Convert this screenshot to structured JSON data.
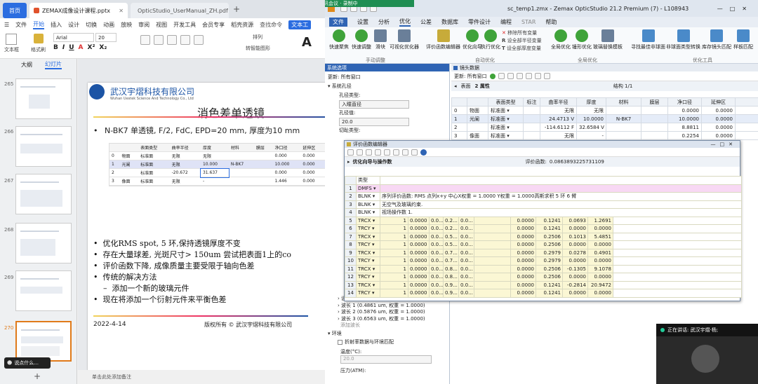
{
  "wps": {
    "tabs": {
      "home": "首页",
      "ppt": "ZEMAX成像设计课程.pptx",
      "pdf": "OpticStudio_UserManual_ZH.pdf"
    },
    "menu": [
      "文件",
      "开始",
      "插入",
      "设计",
      "切换",
      "动画",
      "放映",
      "审阅",
      "视图",
      "开发工具",
      "会员专享",
      "稻壳资源"
    ],
    "menu_selected": "开始",
    "menu_right": [
      "查找命令",
      "文本工"
    ],
    "toolbar": {
      "font": "Arial",
      "size": "20",
      "paste": "文本框",
      "format": "格式刷",
      "layout": "排列",
      "smart": "转智能图形"
    },
    "left_tabs": [
      "大纲",
      "幻灯片"
    ],
    "slide_numbers": [
      "265",
      "266",
      "267",
      "268",
      "269",
      "270"
    ],
    "status_text": "单击此处添加备注",
    "tooltip": "说点什么..."
  },
  "slide": {
    "company_cn": "武汉宇熠科技有限公司",
    "company_en": "Wuhan Uestek Science And Technology Co., Ltd",
    "title": "消色差单透镜",
    "bullet1": "N-BK7 单透镜, F/2, FdC, EPD=20 mm, 厚度为10 mm",
    "table_headers": [
      "表面类型",
      "曲率半径",
      "厚度",
      "材料",
      "膜层",
      "净口径",
      "延伸区"
    ],
    "table_rows": [
      [
        "0",
        "物面",
        "标准面",
        "无限",
        "无限",
        "",
        "",
        "0.000",
        "0.000"
      ],
      [
        "1",
        "光阑",
        "标准面",
        "无限",
        "10.000",
        "N-BK7",
        "",
        "10.000",
        "0.000"
      ],
      [
        "2",
        "",
        "标准面",
        "-20.672",
        "31.637",
        "",
        "",
        "0.000",
        "0.000"
      ],
      [
        "3",
        "像面",
        "标准面",
        "无限",
        "-",
        "",
        "",
        "1.446",
        "0.000"
      ]
    ],
    "bullets": [
      "优化RMS spot, 5 环,保持透镜厚度不变",
      "存在大量球差, 光斑尺寸> 150um 尝试把表面1上的co",
      "评价函数下降, 成像质量主要受限于轴向色差",
      "传统的解决方法",
      "添加一个新的玻璃元件",
      "现在将添加一个衍射元件来平衡色差"
    ],
    "date": "2022-4-14",
    "copyright": "版权所有 © 武汉宇熠科技有限公司"
  },
  "zemax": {
    "title": "sc_temp1.zmx - Zemax OpticStudio 21.2   Premium (7) - L108943",
    "meeting": "腾讯会议 · 录制中",
    "tabs": [
      "文件",
      "设置",
      "分析",
      "优化",
      "公差",
      "数据库",
      "零件设计",
      "编程",
      "STAR",
      "帮助"
    ],
    "ribbon": {
      "b1": "快速聚焦",
      "b2": "快速调整",
      "b3": "滑块",
      "b4": "可视化优化器",
      "b5": "评价函数编辑器",
      "b6": "优化向导",
      "b7": "执行优化",
      "b8": "移除所有变量",
      "b9": "设全部半径变量",
      "b10": "设全部厚度变量",
      "b11": "全局优化",
      "b12": "锤形优化",
      "b13": "玻璃替换模板",
      "b14": "寻找最佳非球面",
      "b15": "非球面类型转换",
      "b16": "库存镜头匹配",
      "b17": "样板匹配",
      "g1": "手动调整",
      "g2": "自动优化",
      "g3": "全局优化",
      "g4": "优化工具"
    },
    "sys_panel": {
      "title": "系统选项",
      "update": "更新: 所有窗口",
      "items": [
        "系统孔径",
        "孔径类型:",
        "入瞳直径",
        "孔径值:",
        "20.0",
        "切趾类型:"
      ],
      "wave_items": [
        "设置",
        "波长 1 (0.4861 um, 权重 = 1.0000)",
        "波长 2 (0.5876 um, 权重 = 1.0000)",
        "波长 3 (0.6563 um, 权重 = 1.0000)",
        "添加波长"
      ],
      "env": "环境",
      "env_opt": "折射率数据与环境匹配",
      "temp_label": "温度(°C):",
      "temp": "20.0",
      "press_label": "压力(ATM):"
    },
    "lens": {
      "title": "镜头数据",
      "update": "更新: 所有窗口",
      "surface": "表面",
      "props": "2 属性",
      "struct": "结构 1/1",
      "headers": [
        "表面类型",
        "标注",
        "曲率半径",
        "厚度",
        "材料",
        "膜层",
        "净口径",
        "延伸区"
      ],
      "rows": [
        [
          "0",
          "物面",
          "标准面 ▾",
          "",
          "无限",
          "无限",
          "",
          "",
          "0.0000",
          "0.0000"
        ],
        [
          "1",
          "光阑",
          "标准面 ▾",
          "",
          "24.4713 V",
          "10.0000",
          "N-BK7",
          "",
          "10.0000",
          "0.0000"
        ],
        [
          "2",
          "",
          "标准面 ▾",
          "",
          "-114.6112 F",
          "32.6584 V",
          "",
          "",
          "8.8811",
          "0.0000"
        ],
        [
          "3",
          "像面",
          "标准面 ▾",
          "",
          "无限",
          "-",
          "",
          "",
          "0.2254",
          "0.0000"
        ]
      ]
    },
    "merit": {
      "title": "评价函数编辑器",
      "wizard": "优化向导与操作数",
      "func_label": "评价函数:",
      "func_value": "0.0863893225731109",
      "header": "类型",
      "rows": [
        [
          "1",
          "DMFS ▾",
          "",
          "",
          "",
          "",
          "",
          "",
          "",
          "",
          "",
          ""
        ],
        [
          "2",
          "BLNK ▾",
          "序列评价函数: RMS 点列x+y 中心X权重 = 1.0000 Y权重 = 1.0000高斯求积 5 环 6 臂",
          "",
          "",
          "",
          "",
          "",
          "",
          "",
          "",
          ""
        ],
        [
          "3",
          "BLNK ▾",
          "无空气及玻璃约束.",
          "",
          "",
          "",
          "",
          "",
          "",
          "",
          "",
          ""
        ],
        [
          "4",
          "BLNK ▾",
          "视场操作数 1.",
          "",
          "",
          "",
          "",
          "",
          "",
          "",
          "",
          ""
        ],
        [
          "5",
          "TRCX ▾",
          "1",
          "0.0000",
          "0.0...",
          "0.2...",
          "0.0...",
          "",
          "0.0000",
          "0.1241",
          "0.0693",
          "1.2691"
        ],
        [
          "6",
          "TRCY ▾",
          "1",
          "0.0000",
          "0.0...",
          "0.2...",
          "0.0...",
          "",
          "0.0000",
          "0.1241",
          "0.0000",
          "0.0000"
        ],
        [
          "7",
          "TRCX ▾",
          "1",
          "0.0000",
          "0.0...",
          "0.5...",
          "0.0...",
          "",
          "0.0000",
          "0.2506",
          "0.1013",
          "5.4851"
        ],
        [
          "8",
          "TRCY ▾",
          "1",
          "0.0000",
          "0.0...",
          "0.5...",
          "0.0...",
          "",
          "0.0000",
          "0.2506",
          "0.0000",
          "0.0000"
        ],
        [
          "9",
          "TRCX ▾",
          "1",
          "0.0000",
          "0.0...",
          "0.7...",
          "0.0...",
          "",
          "0.0000",
          "0.2979",
          "0.0278",
          "0.4901"
        ],
        [
          "10",
          "TRCY ▾",
          "1",
          "0.0000",
          "0.0...",
          "0.7...",
          "0.0...",
          "",
          "0.0000",
          "0.2979",
          "0.0000",
          "0.0000"
        ],
        [
          "11",
          "TRCX ▾",
          "1",
          "0.0000",
          "0.0...",
          "0.8...",
          "0.0...",
          "",
          "0.0000",
          "0.2506",
          "-0.1305",
          "9.1078"
        ],
        [
          "12",
          "TRCY ▾",
          "1",
          "0.0000",
          "0.0...",
          "0.8...",
          "0.0...",
          "",
          "0.0000",
          "0.2506",
          "0.0000",
          "0.0000"
        ],
        [
          "13",
          "TRCX ▾",
          "1",
          "0.0000",
          "0.0...",
          "0.9...",
          "0.0...",
          "",
          "0.0000",
          "0.1241",
          "-0.2814",
          "20.9472"
        ],
        [
          "14",
          "TRCY ▾",
          "1",
          "0.0000",
          "0.0...",
          "0.9...",
          "0.0...",
          "",
          "0.0000",
          "0.1241",
          "0.0000",
          "0.0000"
        ]
      ]
    },
    "video_speaking": "正在讲话: 武汉宇熠·杨;"
  }
}
